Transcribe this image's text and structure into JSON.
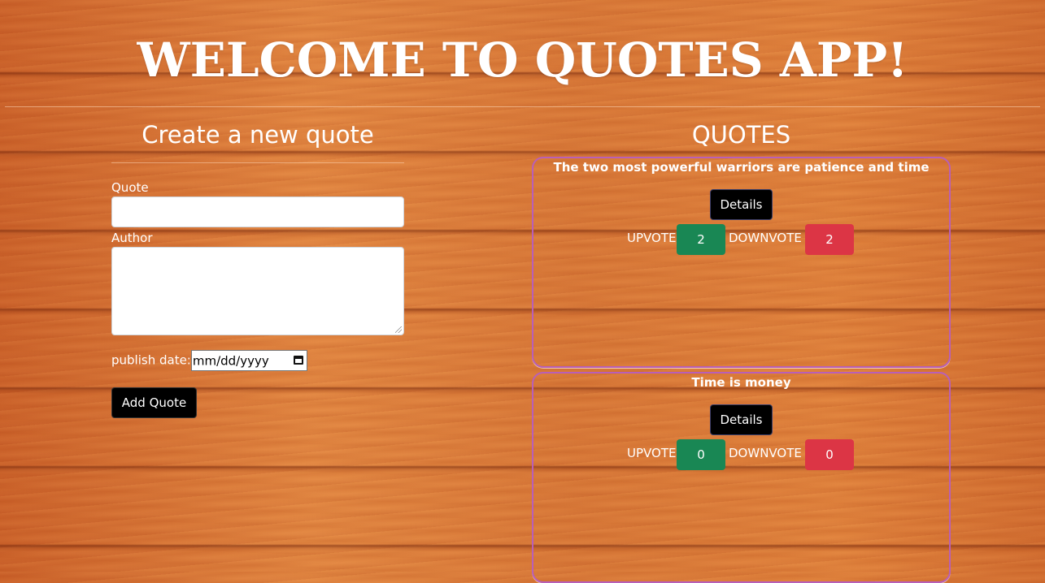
{
  "page_title": "WELCOME TO QUOTES APP!",
  "form": {
    "heading": "Create a new quote",
    "quote_label": "Quote",
    "quote_value": "",
    "author_label": "Author",
    "author_value": "",
    "date_label": "publish date:",
    "date_placeholder": "mm/dd/yyyy",
    "submit_label": "Add Quote"
  },
  "quotes_section": {
    "heading": "QUOTES",
    "items": [
      {
        "text": "The two most powerful warriors are patience and time",
        "details_label": "Details",
        "upvote_label": "UPVOTE",
        "upvotes": "2",
        "downvote_label": "DOWNVOTE",
        "downvotes": "2"
      },
      {
        "text": "Time is money",
        "details_label": "Details",
        "upvote_label": "UPVOTE",
        "upvotes": "0",
        "downvote_label": "DOWNVOTE",
        "downvotes": "0"
      }
    ]
  },
  "colors": {
    "upvote": "#198754",
    "downvote": "#dc3545",
    "card_border": "#b85fb8"
  },
  "icons": {
    "date_picker": "calendar-icon"
  }
}
